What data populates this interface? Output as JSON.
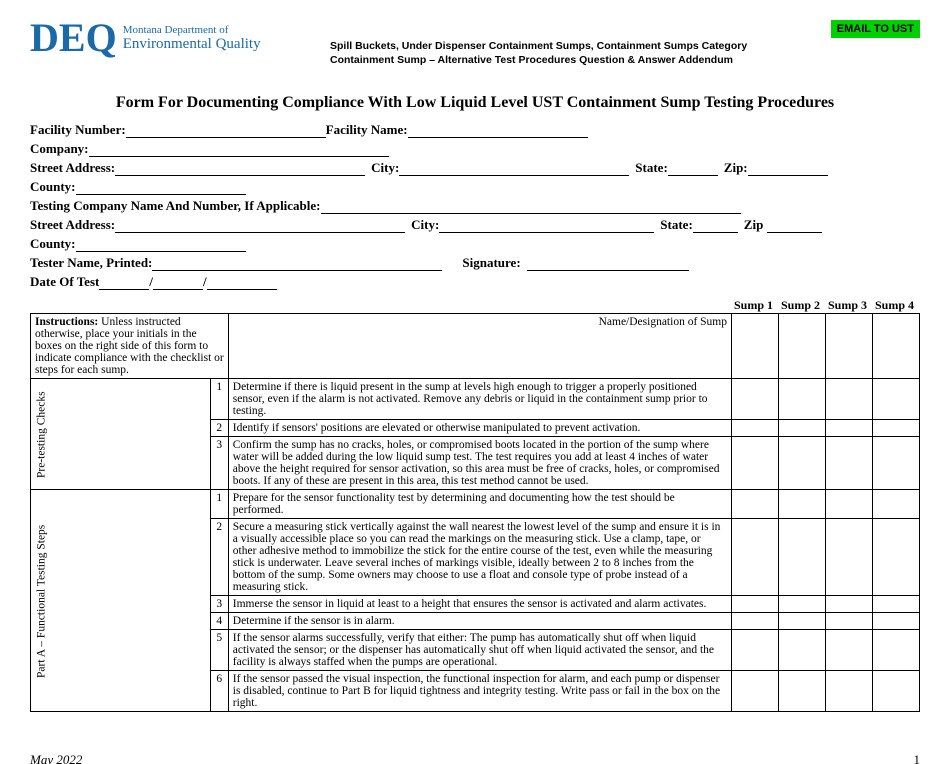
{
  "logo": {
    "abbr": "DEQ",
    "line1": "Montana Department of",
    "line2": "Environmental Quality"
  },
  "email_button": "EMAIL TO UST",
  "header_sub_line1": "Spill Buckets, Under Dispenser Containment Sumps, Containment Sumps Category",
  "header_sub_line2": "Containment Sump – Alternative Test Procedures Question & Answer Addendum",
  "title": "Form For Documenting Compliance With Low Liquid Level UST Containment Sump Testing Procedures",
  "labels": {
    "facility_number": "Facility Number:",
    "facility_name": "Facility Name:",
    "company": "Company:",
    "street_address": "Street Address:",
    "city": "City:",
    "state": "State:",
    "zip": "Zip:",
    "zip2": "Zip",
    "county": "County:",
    "testing_company": "Testing Company Name And Number, If Applicable:",
    "tester_name": "Tester Name, Printed:",
    "signature": "Signature:",
    "date_of_test": "Date Of Test",
    "slash": "/"
  },
  "sump_headers": [
    "Sump 1",
    "Sump 2",
    "Sump 3",
    "Sump 4"
  ],
  "instructions_label": "Instructions:",
  "instructions_text": " Unless instructed otherwise, place your initials in the boxes on the right side of this form to indicate compliance with the checklist or steps for each sump.",
  "name_designation": "Name/Designation of Sump",
  "section_pre": "Pre-testing Checks",
  "section_partA": "Part A – Functional Testing Steps",
  "pre_rows": [
    "Determine if there is liquid present in the sump at levels high enough to trigger a properly positioned sensor, even if the alarm is not activated. Remove any debris or liquid in the containment sump prior to testing.",
    "Identify if sensors' positions are elevated or otherwise manipulated to prevent activation.",
    "Confirm the sump has no cracks, holes, or compromised boots located in the portion of the sump where water will be added during the low liquid sump test. The test requires you add at least 4 inches of water above the height required for sensor activation, so this area must be free of cracks, holes, or compromised boots. If any of these are present in this area, this test method cannot be used."
  ],
  "partA_rows": [
    "Prepare for the sensor functionality test by determining and documenting how the test should be performed.",
    "Secure a measuring stick vertically against the wall nearest the lowest level of the sump and ensure it is in a visually accessible place so you can read the markings on the measuring stick. Use a clamp, tape, or other adhesive method to immobilize the stick for the entire course of the test, even while the measuring stick is underwater. Leave several inches of markings visible, ideally between 2 to 8 inches from the bottom of the sump. Some owners may choose to use a float and console type of probe instead of a measuring stick.",
    "Immerse the sensor in liquid at least to a height that ensures the sensor is activated and alarm activates.",
    "Determine if the sensor is in alarm.",
    "If the sensor alarms successfully, verify that either: The pump has automatically shut off when liquid activated the sensor; or the dispenser has automatically shut off when liquid activated the sensor, and the facility is always staffed when the pumps are operational.",
    "If the sensor passed the visual inspection, the functional inspection for alarm, and each pump or dispenser is disabled, continue to Part B for liquid tightness and integrity testing. Write pass or fail in the box on the right."
  ],
  "footer": {
    "date": "May 2022",
    "page": "1"
  }
}
